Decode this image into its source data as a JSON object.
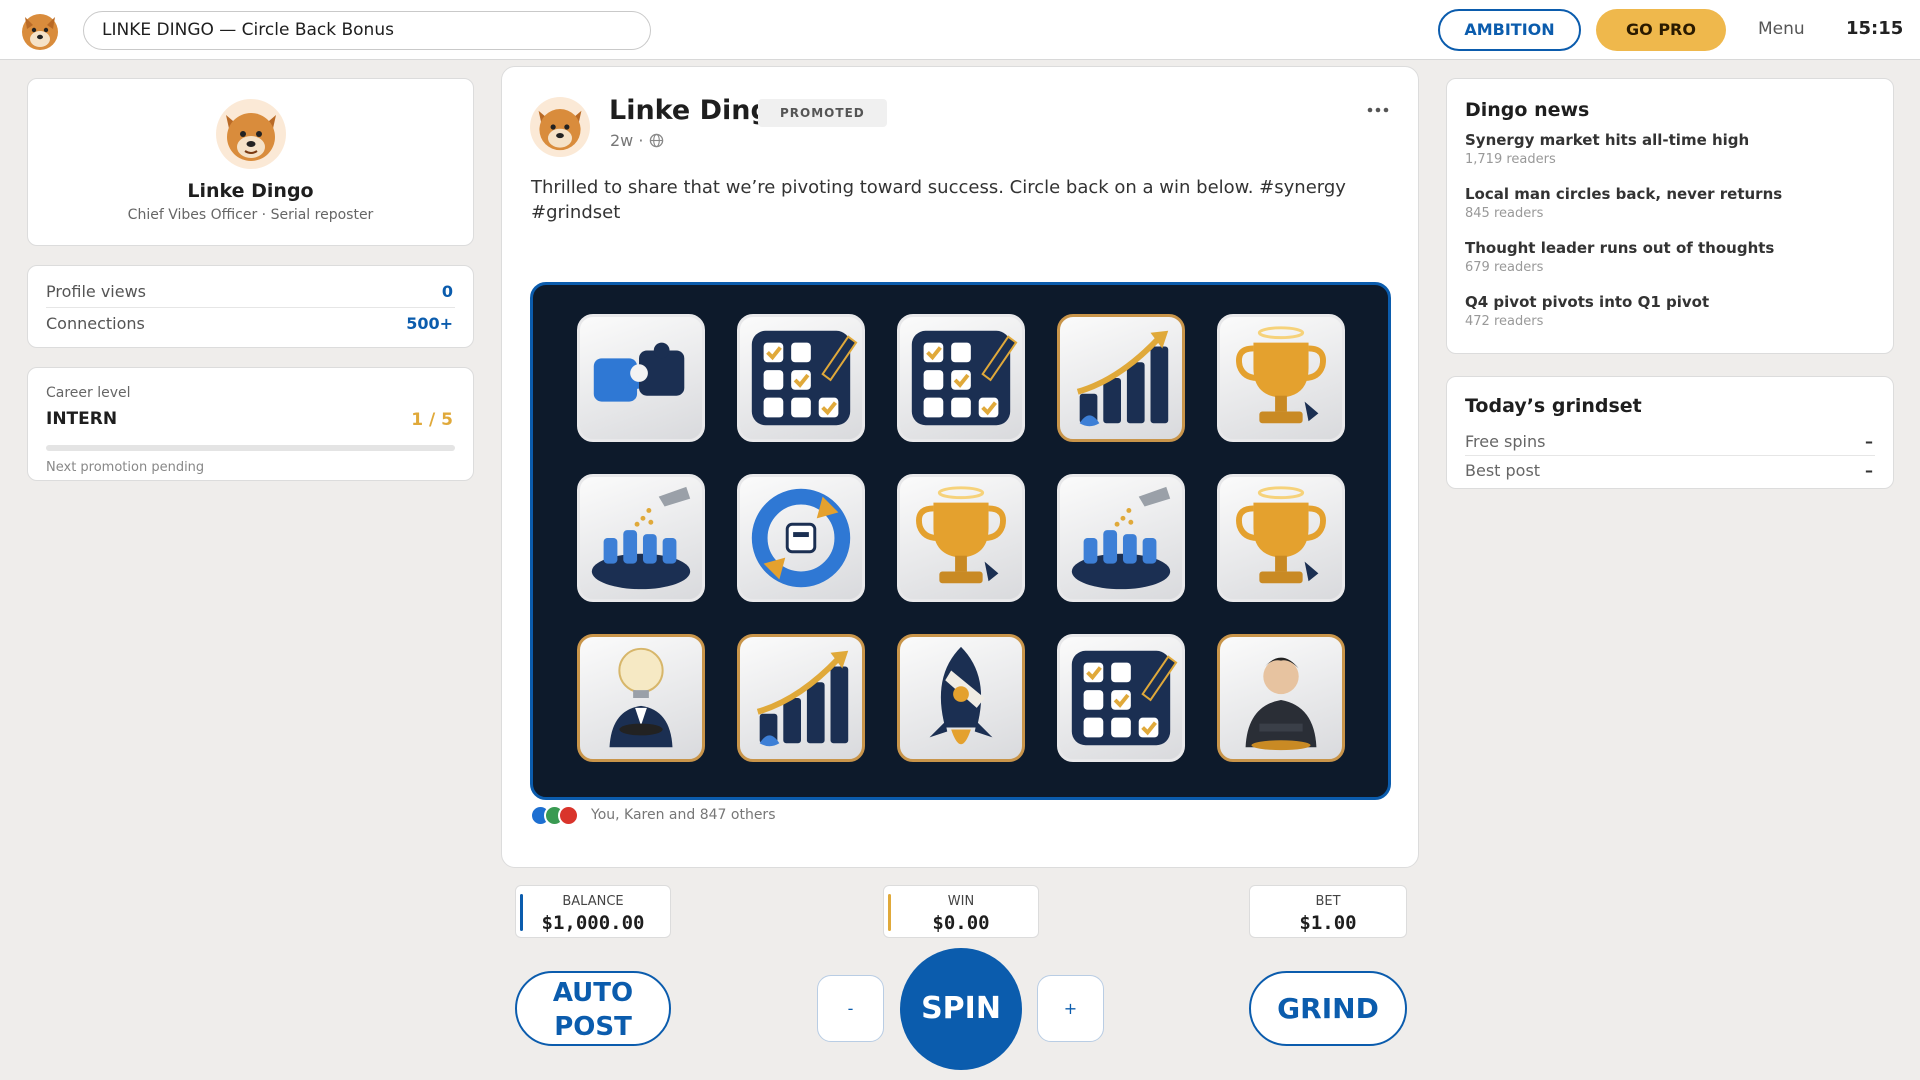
{
  "topbar": {
    "address": "LINKE DINGO — Circle Back Bonus",
    "ambition_label": "AMBITION",
    "gopro_label": "GO PRO",
    "menu_label": "Menu",
    "clock": "15:15"
  },
  "profile": {
    "name": "Linke Dingo",
    "title": "Chief Vibes Officer · Serial reposter",
    "stats": [
      {
        "label": "Profile views",
        "value": "0"
      },
      {
        "label": "Connections",
        "value": "500+"
      }
    ],
    "career": {
      "label": "Career level",
      "level": "INTERN",
      "fraction": "1 / 5",
      "progress": 0.0,
      "note": "Next promotion pending"
    }
  },
  "post": {
    "author": "Linke Dingo",
    "badge": "PROMOTED",
    "meta": "2w · ",
    "text": "Thrilled to share that we’re pivoting toward success. Circle back on a win below. #synergy #grindset",
    "reactions_text": "You, Karen and 847 others",
    "reels": [
      [
        "puzzle-icon",
        "checklist-icon",
        "checklist-icon",
        "growth-chart-icon",
        "trophy-icon"
      ],
      [
        "thumbs-up-crowd-icon",
        "cycle-icon",
        "trophy-icon",
        "thumbs-up-crowd-icon",
        "trophy-icon"
      ],
      [
        "idea-executive-icon",
        "growth-chart-icon",
        "rocket-icon",
        "checklist-icon",
        "executive-icon"
      ]
    ],
    "reel_frames": [
      [
        "silver",
        "silver",
        "silver",
        "gold",
        "silver"
      ],
      [
        "silver",
        "silver",
        "silver",
        "silver",
        "silver"
      ],
      [
        "gold",
        "gold",
        "gold",
        "silver",
        "gold"
      ]
    ]
  },
  "controls": {
    "balance_label": "BALANCE",
    "balance_value": "$1,000.00",
    "win_label": "WIN",
    "win_value": "$0.00",
    "bet_label": "BET",
    "bet_value": "$1.00",
    "auto_label_1": "AUTO",
    "auto_label_2": "POST",
    "minus_label": "-",
    "spin_label": "SPIN",
    "plus_label": "+",
    "grind_label": "GRIND"
  },
  "news": {
    "heading": "Dingo news",
    "items": [
      {
        "title": "Synergy market hits all-time high",
        "sub": "1,719 readers"
      },
      {
        "title": "Local man circles back, never returns",
        "sub": "845 readers"
      },
      {
        "title": "Thought leader runs out of thoughts",
        "sub": "679 readers"
      },
      {
        "title": "Q4 pivot pivots into Q1 pivot",
        "sub": "472 readers"
      }
    ]
  },
  "grindset": {
    "heading": "Today’s grindset",
    "rows": [
      {
        "label": "Free spins",
        "value": "–"
      },
      {
        "label": "Best post",
        "value": "–"
      }
    ]
  },
  "colors": {
    "accent": "#0b5cad",
    "gold": "#efb84c",
    "reel_bg": "#0d1a2b"
  }
}
